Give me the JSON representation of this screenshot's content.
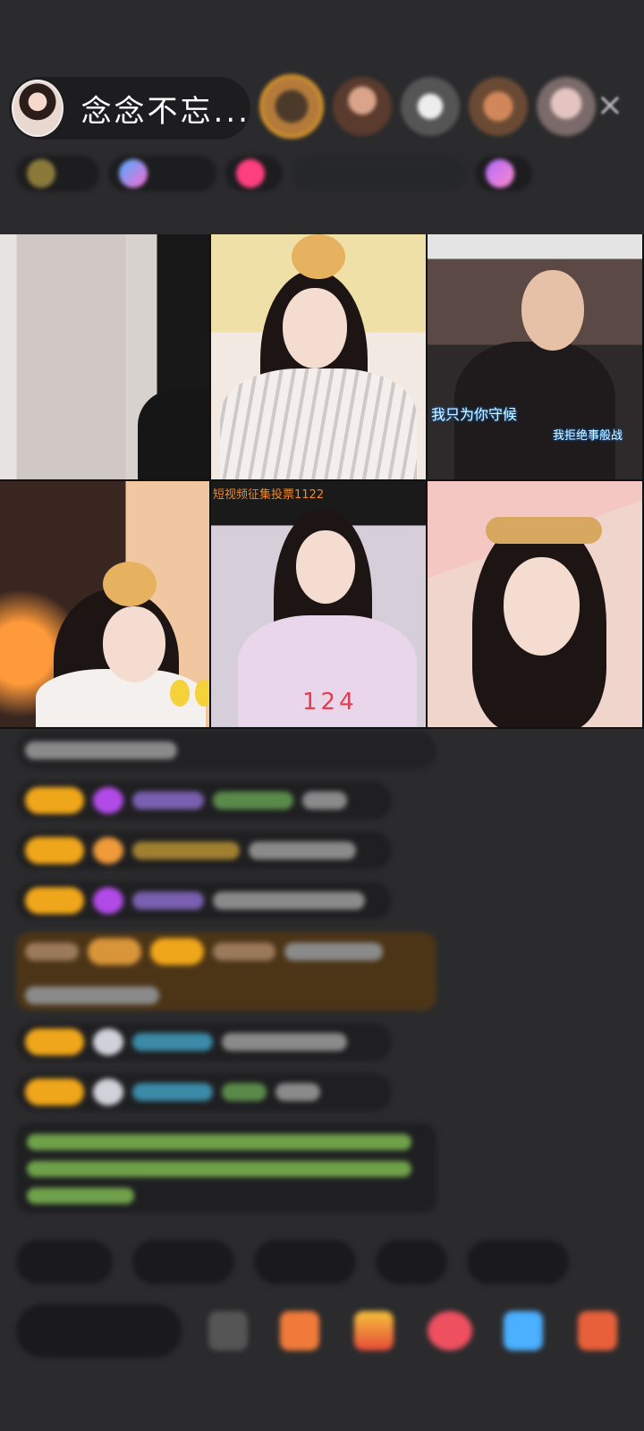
{
  "host": {
    "name": "念念不忘...",
    "avatar_icon": "host-avatar-icon"
  },
  "viewers": [
    "viewer-avatar-1",
    "viewer-avatar-2",
    "viewer-avatar-3",
    "viewer-avatar-4",
    "viewer-avatar-5"
  ],
  "close_icon": "×",
  "video": {
    "caption_1": "我只为你守候",
    "caption_2": "我拒绝事般战",
    "vote_text": "短视频征集投票1122",
    "score": "124"
  },
  "colors": {
    "background": "#2b2b2d",
    "badge": "#f0a61a",
    "score": "#e83a4a",
    "vote": "#f08a2a"
  }
}
